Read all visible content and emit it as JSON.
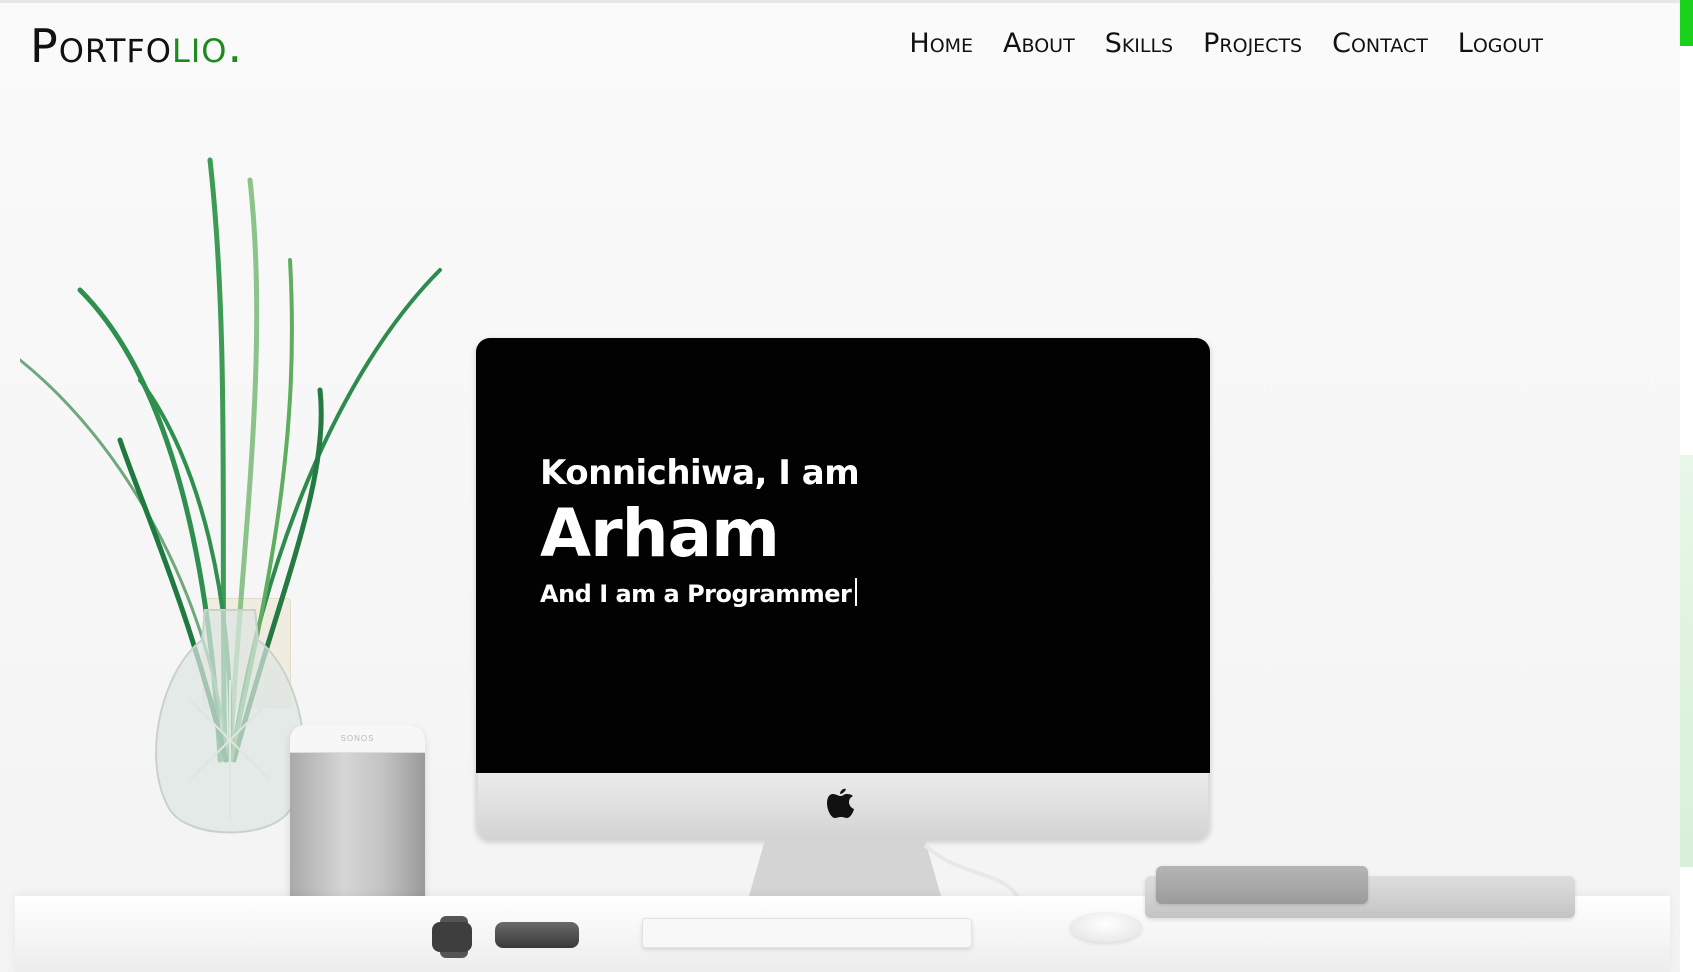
{
  "header": {
    "logo_main": "Portfo",
    "logo_accent": "lio."
  },
  "nav": {
    "items": [
      "Home",
      "About",
      "Skills",
      "Projects",
      "Contact",
      "Logout"
    ]
  },
  "hero": {
    "greeting": "Konnichiwa, I am",
    "name": "Arham",
    "role": "And I am a Programmer"
  },
  "speaker": {
    "brand": "SONOS"
  },
  "colors": {
    "accent_green": "#1c8a1c",
    "scroll_thumb": "#18d118",
    "screen_black": "#020202"
  },
  "icons": [
    "apple-logo-icon"
  ]
}
